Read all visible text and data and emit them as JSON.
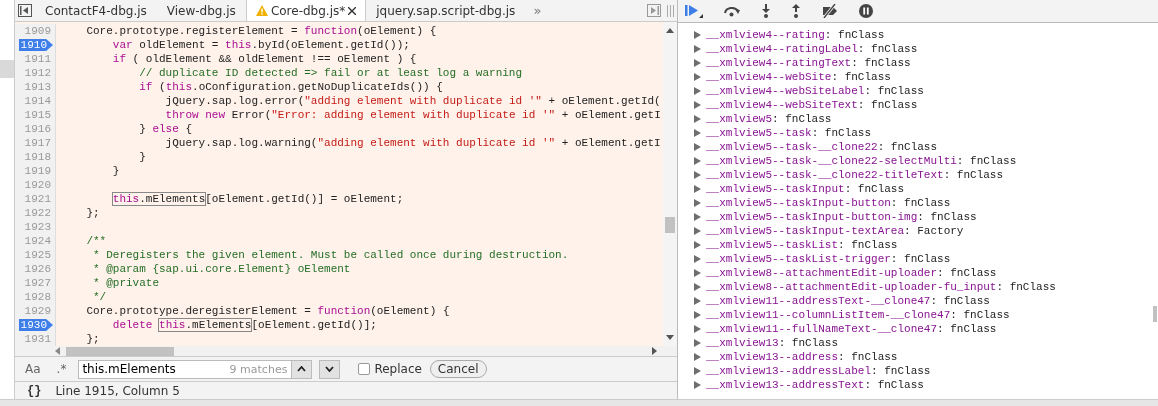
{
  "tabs": [
    {
      "label": "ContactF4-dbg.js",
      "selected": false,
      "warning": false,
      "closable": false
    },
    {
      "label": "View-dbg.js",
      "selected": false,
      "warning": false,
      "closable": false
    },
    {
      "label": "Core-dbg.js*",
      "selected": true,
      "warning": true,
      "closable": true
    },
    {
      "label": "jquery.sap.script-dbg.js",
      "selected": false,
      "warning": false,
      "closable": false
    }
  ],
  "tab_overflow": "»",
  "code_lines": [
    {
      "number": "1909",
      "breakpoint": false,
      "segments": [
        {
          "kind": "plain",
          "text": "    Core.prototype.registerElement = "
        },
        {
          "kind": "keyword",
          "text": "function"
        },
        {
          "kind": "plain",
          "text": "(oElement) {"
        }
      ]
    },
    {
      "number": "1910",
      "breakpoint": true,
      "segments": [
        {
          "kind": "keyword",
          "text": "        var"
        },
        {
          "kind": "plain",
          "text": " oldElement = "
        },
        {
          "kind": "keyword",
          "text": "this"
        },
        {
          "kind": "plain",
          "text": ".byId(oElement.getId());"
        }
      ]
    },
    {
      "number": "1911",
      "breakpoint": false,
      "segments": [
        {
          "kind": "keyword",
          "text": "        if"
        },
        {
          "kind": "plain",
          "text": " ( oldElement && oldElement !== oElement ) {"
        }
      ]
    },
    {
      "number": "1912",
      "breakpoint": false,
      "segments": [
        {
          "kind": "comment",
          "text": "            // duplicate ID detected => fail or at least log a warning"
        }
      ]
    },
    {
      "number": "1913",
      "breakpoint": false,
      "segments": [
        {
          "kind": "keyword",
          "text": "            if"
        },
        {
          "kind": "plain",
          "text": " ("
        },
        {
          "kind": "keyword",
          "text": "this"
        },
        {
          "kind": "plain",
          "text": ".oConfiguration.getNoDuplicateIds()) {"
        }
      ]
    },
    {
      "number": "1914",
      "breakpoint": false,
      "segments": [
        {
          "kind": "plain",
          "text": "                jQuery.sap.log.error("
        },
        {
          "kind": "string",
          "text": "\"adding element with duplicate id '\""
        },
        {
          "kind": "plain",
          "text": " + oElement.getId("
        }
      ]
    },
    {
      "number": "1915",
      "breakpoint": false,
      "segments": [
        {
          "kind": "keyword",
          "text": "                throw new"
        },
        {
          "kind": "plain",
          "text": " Error("
        },
        {
          "kind": "string",
          "text": "\"Error: adding element with duplicate id '\""
        },
        {
          "kind": "plain",
          "text": " + oElement.getI"
        }
      ]
    },
    {
      "number": "1916",
      "breakpoint": false,
      "segments": [
        {
          "kind": "plain",
          "text": "            } "
        },
        {
          "kind": "keyword",
          "text": "else"
        },
        {
          "kind": "plain",
          "text": " {"
        }
      ]
    },
    {
      "number": "1917",
      "breakpoint": false,
      "segments": [
        {
          "kind": "plain",
          "text": "                jQuery.sap.log.warning("
        },
        {
          "kind": "string",
          "text": "\"adding element with duplicate id '\""
        },
        {
          "kind": "plain",
          "text": " + oElement.getI"
        }
      ]
    },
    {
      "number": "1918",
      "breakpoint": false,
      "segments": [
        {
          "kind": "plain",
          "text": "            }"
        }
      ]
    },
    {
      "number": "1919",
      "breakpoint": false,
      "segments": [
        {
          "kind": "plain",
          "text": "        }"
        }
      ]
    },
    {
      "number": "1920",
      "breakpoint": false
    },
    {
      "number": "1921",
      "breakpoint": false,
      "segments": [
        {
          "kind": "match",
          "parts": [
            {
              "kind": "keyword",
              "text": "        this"
            },
            {
              "kind": "plain",
              "text": ".mElements"
            }
          ]
        },
        {
          "kind": "plain",
          "text": "[oElement.getId()] = oElement;"
        }
      ]
    },
    {
      "number": "1922",
      "breakpoint": false,
      "segments": [
        {
          "kind": "plain",
          "text": "    };"
        }
      ]
    },
    {
      "number": "1923",
      "breakpoint": false
    },
    {
      "number": "1924",
      "breakpoint": false,
      "segments": [
        {
          "kind": "comment",
          "text": "    /**"
        }
      ]
    },
    {
      "number": "1925",
      "breakpoint": false,
      "segments": [
        {
          "kind": "comment",
          "text": "     * Deregisters the given element. Must be called once during destruction."
        }
      ]
    },
    {
      "number": "1926",
      "breakpoint": false,
      "segments": [
        {
          "kind": "comment",
          "text": "     * @param {sap.ui.core.Element} oElement"
        }
      ]
    },
    {
      "number": "1927",
      "breakpoint": false,
      "segments": [
        {
          "kind": "comment",
          "text": "     * @private"
        }
      ]
    },
    {
      "number": "1928",
      "breakpoint": false,
      "segments": [
        {
          "kind": "comment",
          "text": "     */"
        }
      ]
    },
    {
      "number": "1929",
      "breakpoint": false,
      "segments": [
        {
          "kind": "plain",
          "text": "    Core.prototype.deregisterElement = "
        },
        {
          "kind": "keyword",
          "text": "function"
        },
        {
          "kind": "plain",
          "text": "(oElement) {"
        }
      ]
    },
    {
      "number": "1930",
      "breakpoint": true,
      "segments": [
        {
          "kind": "keyword",
          "text": "        delete "
        },
        {
          "kind": "match",
          "parts": [
            {
              "kind": "keyword",
              "text": "this"
            },
            {
              "kind": "plain",
              "text": ".mElements"
            }
          ]
        },
        {
          "kind": "plain",
          "text": "[oElement.getId()];"
        }
      ]
    },
    {
      "number": "1931",
      "breakpoint": false,
      "segments": [
        {
          "kind": "plain",
          "text": "    };"
        }
      ]
    }
  ],
  "search": {
    "case_toggle": "Aa",
    "regex_toggle": ".*",
    "value": "this.mElements",
    "match_count": "9 matches",
    "replace": {
      "label": "Replace",
      "checked": false
    },
    "cancel": "Cancel"
  },
  "status_bar": {
    "pretty_print": "{}",
    "position": "Line 1915, Column 5"
  },
  "scope_items": [
    {
      "name": "__xmlview4--rating",
      "separator": ":",
      "value": "fnClass",
      "expanded": false
    },
    {
      "name": "__xmlview4--ratingLabel",
      "separator": ":",
      "value": "fnClass",
      "expanded": false
    },
    {
      "name": "__xmlview4--ratingText",
      "separator": ":",
      "value": "fnClass",
      "expanded": false
    },
    {
      "name": "__xmlview4--webSite",
      "separator": ":",
      "value": "fnClass",
      "expanded": false
    },
    {
      "name": "__xmlview4--webSiteLabel",
      "separator": ":",
      "value": "fnClass",
      "expanded": false
    },
    {
      "name": "__xmlview4--webSiteText",
      "separator": ":",
      "value": "fnClass",
      "expanded": false
    },
    {
      "name": "__xmlview5",
      "separator": ":",
      "value": "fnClass",
      "expanded": false
    },
    {
      "name": "__xmlview5--task",
      "separator": ":",
      "value": "fnClass",
      "expanded": false
    },
    {
      "name": "__xmlview5--task-__clone22",
      "separator": ":",
      "value": "fnClass",
      "expanded": false
    },
    {
      "name": "__xmlview5--task-__clone22-selectMulti",
      "separator": ":",
      "value": "fnClass",
      "expanded": false
    },
    {
      "name": "__xmlview5--task-__clone22-titleText",
      "separator": ":",
      "value": "fnClass",
      "expanded": false
    },
    {
      "name": "__xmlview5--taskInput",
      "separator": ":",
      "value": "fnClass",
      "expanded": false
    },
    {
      "name": "__xmlview5--taskInput-button",
      "separator": ":",
      "value": "fnClass",
      "expanded": false
    },
    {
      "name": "__xmlview5--taskInput-button-img",
      "separator": ":",
      "value": "fnClass",
      "expanded": false
    },
    {
      "name": "__xmlview5--taskInput-textArea",
      "separator": ":",
      "value": "Factory",
      "expanded": false
    },
    {
      "name": "__xmlview5--taskList",
      "separator": ":",
      "value": "fnClass",
      "expanded": false
    },
    {
      "name": "__xmlview5--taskList-trigger",
      "separator": ":",
      "value": "fnClass",
      "expanded": false
    },
    {
      "name": "__xmlview8--attachmentEdit-uploader",
      "separator": ":",
      "value": "fnClass",
      "expanded": false
    },
    {
      "name": "__xmlview8--attachmentEdit-uploader-fu_input",
      "separator": ":",
      "value": "fnClass",
      "expanded": false
    },
    {
      "name": "__xmlview11--addressText-__clone47",
      "separator": ":",
      "value": "fnClass",
      "expanded": false
    },
    {
      "name": "__xmlview11--columnListItem-__clone47",
      "separator": ":",
      "value": "fnClass",
      "expanded": false
    },
    {
      "name": "__xmlview11--fullNameText-__clone47",
      "separator": ":",
      "value": "fnClass",
      "expanded": false
    },
    {
      "name": "__xmlview13",
      "separator": ":",
      "value": "fnClass",
      "expanded": false
    },
    {
      "name": "__xmlview13--address",
      "separator": ":",
      "value": "fnClass",
      "expanded": false
    },
    {
      "name": "__xmlview13--addressLabel",
      "separator": ":",
      "value": "fnClass",
      "expanded": false
    },
    {
      "name": "__xmlview13--addressText",
      "separator": ":",
      "value": "fnClass",
      "expanded": false
    }
  ]
}
